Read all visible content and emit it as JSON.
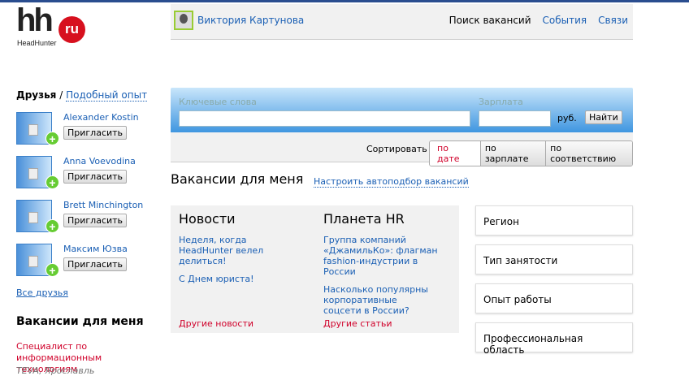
{
  "logo": {
    "brand": "hh",
    "badge": "ru",
    "sub": "HeadHunter"
  },
  "header": {
    "user_name": "Виктория Картунова",
    "nav": [
      "Поиск вакансий",
      "События",
      "Связи"
    ]
  },
  "friends": {
    "title": "Друзья",
    "sep": "/",
    "similar": "Подобный опыт",
    "invite_label": "Пригласить",
    "all_label": "Все друзья",
    "items": [
      {
        "name": "Alexander Kostin"
      },
      {
        "name": "Anna Voevodina"
      },
      {
        "name": "Brett Minchington"
      },
      {
        "name": "Максим Юзва"
      }
    ]
  },
  "side_vacancies": {
    "title": "Вакансии для меня",
    "item_title": "Специалист по информационным технологиям",
    "item_company": "TEVA, Ярославль"
  },
  "search": {
    "keywords_label": "Ключевые слова",
    "keywords_value": "",
    "salary_label": "Зарплата",
    "salary_value": "",
    "currency": "руб.",
    "find": "Найти"
  },
  "sort": {
    "label": "Сортировать",
    "options": [
      "по дате",
      "по зарплате",
      "по соответствию"
    ],
    "selected": "по дате"
  },
  "main": {
    "title": "Вакансии для меня",
    "auto_link": "Настроить автоподбор вакансий"
  },
  "news": {
    "title": "Новости",
    "items": [
      "Неделя, когда HeadHunter велел делиться!",
      "С Днем юриста!"
    ],
    "more": "Другие новости"
  },
  "hr": {
    "title": "Планета HR",
    "items": [
      "Группа компаний «ДжамильКо»: флагман fashion-индустрии в России",
      "Насколько популярны корпоративные соцсети в России?"
    ],
    "more": "Другие статьи"
  },
  "filters": [
    "Регион",
    "Тип занятости",
    "Опыт работы",
    "Профессиональная область"
  ]
}
